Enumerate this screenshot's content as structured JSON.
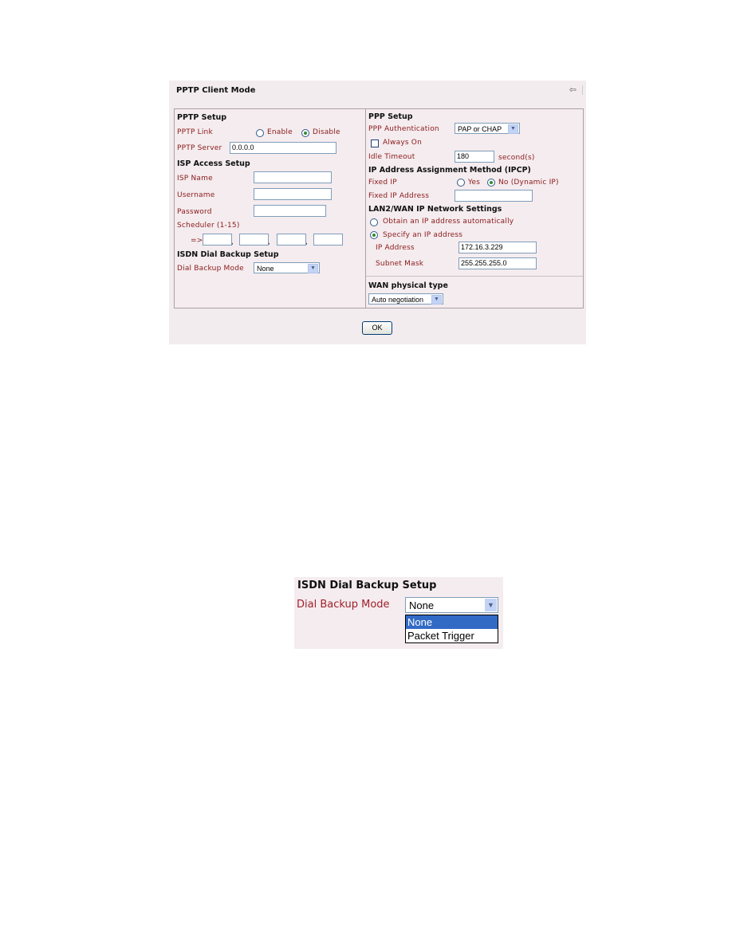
{
  "panel": {
    "title": "PPTP Client Mode",
    "back_icon": "⇦",
    "ok_label": "OK"
  },
  "pptp_setup": {
    "heading": "PPTP Setup",
    "link_label": "PPTP Link",
    "link_options": [
      {
        "label": "Enable",
        "selected": false
      },
      {
        "label": "Disable",
        "selected": true
      }
    ],
    "server_label": "PPTP Server",
    "server_value": "0.0.0.0"
  },
  "isp_setup": {
    "heading": "ISP Access Setup",
    "name_label": "ISP Name",
    "name_value": "",
    "username_label": "Username",
    "username_value": "",
    "password_label": "Password",
    "password_value": "",
    "scheduler_label": "Scheduler (1-15)",
    "scheduler_arrow": "=>",
    "scheduler_values": [
      "",
      "",
      "",
      ""
    ],
    "separator": ","
  },
  "isdn_setup": {
    "heading": "ISDN Dial Backup Setup",
    "mode_label": "Dial Backup Mode",
    "mode_value": "None"
  },
  "ppp_setup": {
    "heading": "PPP Setup",
    "auth_label": "PPP Authentication",
    "auth_value": "PAP or CHAP",
    "always_on_label": "Always On",
    "always_on_checked": false,
    "idle_label": "Idle Timeout",
    "idle_value": "180",
    "idle_unit": "second(s)"
  },
  "ipcp": {
    "heading": "IP Address Assignment Method (IPCP)",
    "fixed_ip_label": "Fixed IP",
    "fixed_ip_options": [
      {
        "label": "Yes",
        "selected": false
      },
      {
        "label": "No (Dynamic IP)",
        "selected": true
      }
    ],
    "fixed_addr_label": "Fixed IP Address",
    "fixed_addr_value": ""
  },
  "lan2wan": {
    "heading": "LAN2/WAN IP Network Settings",
    "obtain_label": "Obtain an IP address automatically",
    "obtain_selected": false,
    "specify_label": "Specify an IP address",
    "specify_selected": true,
    "ip_label": "IP Address",
    "ip_value": "172.16.3.229",
    "mask_label": "Subnet Mask",
    "mask_value": "255.255.255.0"
  },
  "wan_physical": {
    "heading": "WAN physical type",
    "value": "Auto negotiation"
  },
  "dropdown_detail": {
    "heading": "ISDN Dial Backup Setup",
    "label": "Dial Backup Mode",
    "value": "None",
    "options": [
      {
        "label": "None",
        "highlighted": true
      },
      {
        "label": "Packet Trigger",
        "highlighted": false
      }
    ]
  }
}
